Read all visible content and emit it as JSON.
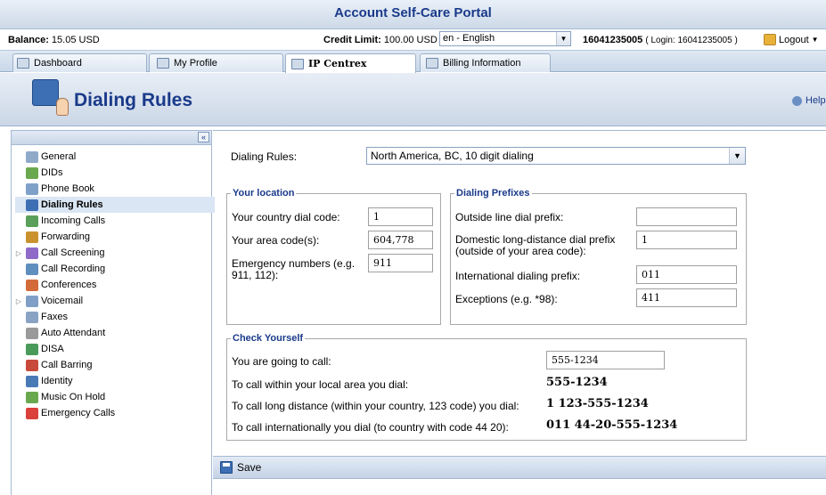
{
  "header": {
    "title": "Account Self-Care Portal"
  },
  "topbar": {
    "balance_label": "Balance:",
    "balance_value": "15.05 USD",
    "credit_label": "Credit Limit:",
    "credit_value": "100.00 USD",
    "language": "en - English",
    "account": "16041235005",
    "login_text": "( Login: 16041235005 )",
    "logout_label": "Logout"
  },
  "tabs": [
    {
      "label": "Dashboard"
    },
    {
      "label": "My Profile"
    },
    {
      "label": "IP Centrex"
    },
    {
      "label": "Billing Information"
    }
  ],
  "page": {
    "title": "Dialing Rules",
    "help_label": "Help"
  },
  "sidebar": {
    "items": [
      {
        "label": "General",
        "icon": "gear-icon",
        "color": "#8fa9c9"
      },
      {
        "label": "DIDs",
        "icon": "dids-icon",
        "color": "#6aa84f"
      },
      {
        "label": "Phone Book",
        "icon": "phone-book-icon",
        "color": "#7fa0c8"
      },
      {
        "label": "Dialing Rules",
        "icon": "dialing-rules-icon",
        "color": "#3d6fb5"
      },
      {
        "label": "Incoming Calls",
        "icon": "incoming-calls-icon",
        "color": "#5aa05a"
      },
      {
        "label": "Forwarding",
        "icon": "forwarding-icon",
        "color": "#c9922e"
      },
      {
        "label": "Call Screening",
        "icon": "call-screening-icon",
        "color": "#8f6ac9"
      },
      {
        "label": "Call Recording",
        "icon": "call-recording-icon",
        "color": "#5f8fbf"
      },
      {
        "label": "Conferences",
        "icon": "conferences-icon",
        "color": "#d36a3a"
      },
      {
        "label": "Voicemail",
        "icon": "voicemail-icon",
        "color": "#7f9fc6"
      },
      {
        "label": "Faxes",
        "icon": "fax-icon",
        "color": "#8aa3c4"
      },
      {
        "label": "Auto Attendant",
        "icon": "auto-attendant-icon",
        "color": "#9a9a9a"
      },
      {
        "label": "DISA",
        "icon": "disa-icon",
        "color": "#4a9a5a"
      },
      {
        "label": "Call Barring",
        "icon": "call-barring-icon",
        "color": "#c84a3a"
      },
      {
        "label": "Identity",
        "icon": "identity-icon",
        "color": "#4a7ab5"
      },
      {
        "label": "Music On Hold",
        "icon": "music-on-hold-icon",
        "color": "#6aa84f"
      },
      {
        "label": "Emergency Calls",
        "icon": "emergency-calls-icon",
        "color": "#d9413a"
      }
    ]
  },
  "form": {
    "dialing_rules_label": "Dialing Rules:",
    "dialing_rules_value": "North America, BC, 10 digit dialing",
    "location": {
      "legend": "Your location",
      "country_label": "Your country dial code:",
      "country_value": "1",
      "area_label": "Your area code(s):",
      "area_value": "604,778",
      "emergency_label": "Emergency numbers (e.g. 911, 112):",
      "emergency_value": "911"
    },
    "prefixes": {
      "legend": "Dialing Prefixes",
      "outside_label": "Outside line dial prefix:",
      "outside_value": "",
      "domestic_label": "Domestic long-distance dial prefix (outside of your area code):",
      "domestic_value": "1",
      "international_label": "International dialing prefix:",
      "international_value": "011",
      "exceptions_label": "Exceptions (e.g. *98):",
      "exceptions_value": "411"
    },
    "check": {
      "legend": "Check Yourself",
      "going_label": "You are going to call:",
      "going_value": "555-1234",
      "local_label": "To call within your local area you dial:",
      "local_value": "555-1234",
      "long_label": "To call long distance (within your country, 123 code) you dial:",
      "long_value": "1 123-555-1234",
      "intl_label": "To call internationally you dial (to country with code 44 20):",
      "intl_value": "011 44-20-555-1234"
    }
  },
  "footer": {
    "save_label": "Save"
  }
}
